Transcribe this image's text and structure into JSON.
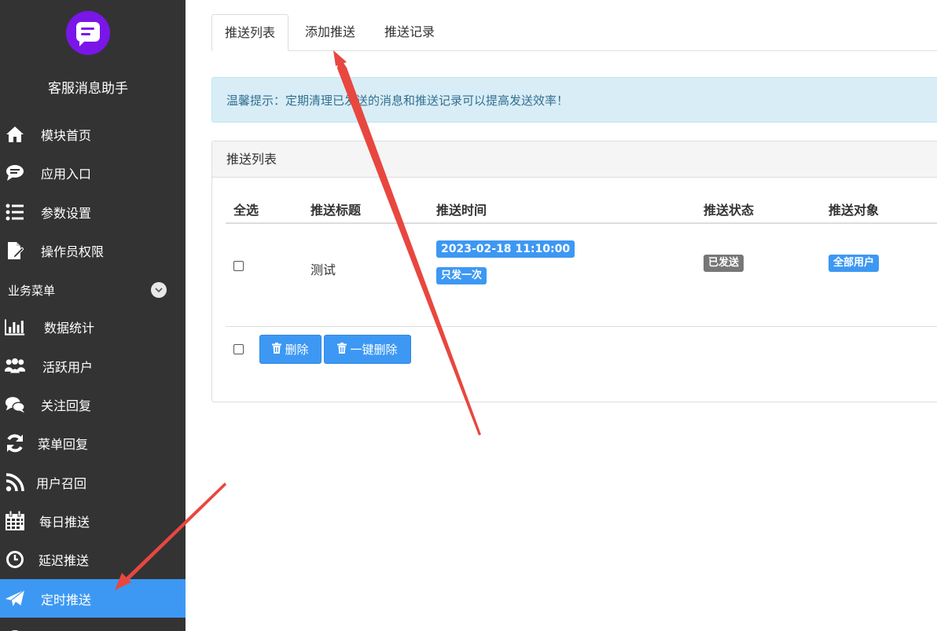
{
  "sidebar": {
    "title": "客服消息助手",
    "items": [
      {
        "label": "模块首页",
        "icon": "home-icon"
      },
      {
        "label": "应用入口",
        "icon": "chat-bubble-icon"
      },
      {
        "label": "参数设置",
        "icon": "list-settings-icon"
      },
      {
        "label": "操作员权限",
        "icon": "document-edit-icon"
      }
    ],
    "section_label": "业务菜单",
    "section_icon": "chevron-down-icon",
    "business_items": [
      {
        "label": "数据统计",
        "icon": "bar-chart-icon"
      },
      {
        "label": "活跃用户",
        "icon": "users-icon"
      },
      {
        "label": "关注回复",
        "icon": "comments-icon"
      },
      {
        "label": "菜单回复",
        "icon": "refresh-icon"
      },
      {
        "label": "用户召回",
        "icon": "rss-icon"
      },
      {
        "label": "每日推送",
        "icon": "calendar-icon"
      },
      {
        "label": "延迟推送",
        "icon": "clock-icon"
      },
      {
        "label": "定时推送",
        "icon": "paper-plane-icon",
        "active": true
      }
    ]
  },
  "tabs": [
    {
      "label": "推送列表",
      "active": true
    },
    {
      "label": "添加推送",
      "active": false
    },
    {
      "label": "推送记录",
      "active": false
    }
  ],
  "alert": {
    "text": "温馨提示：定期清理已发送的消息和推送记录可以提高发送效率！"
  },
  "panel": {
    "title": "推送列表",
    "columns": [
      "全选",
      "推送标题",
      "推送时间",
      "推送状态",
      "推送对象"
    ],
    "rows": [
      {
        "title": "测试",
        "time": "2023-02-18 11:10:00",
        "frequency": "只发一次",
        "status": "已发送",
        "target": "全部用户"
      }
    ],
    "actions": {
      "delete": "删除",
      "delete_all": "一键删除"
    }
  },
  "colors": {
    "sidebar_bg": "#333333",
    "accent": "#3d98f3",
    "annotation_arrow": "#e8473f",
    "logo": "#7a16e8"
  }
}
